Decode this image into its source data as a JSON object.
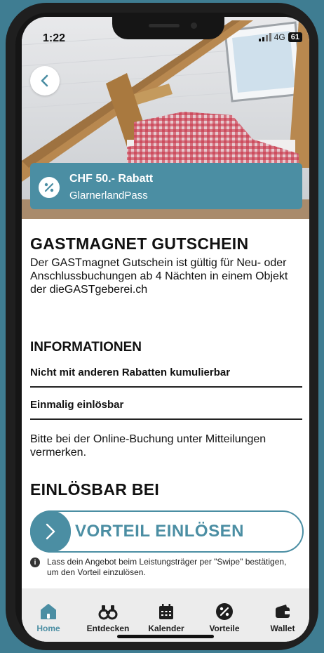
{
  "status_bar": {
    "time": "1:22",
    "network": "4G",
    "battery": "61"
  },
  "hero": {
    "back_button": "chevron-left-icon"
  },
  "discount": {
    "title": "CHF 50.- Rabatt",
    "partner": "GlarnerlandPass",
    "icon": "percent-icon"
  },
  "offer": {
    "title": "GASTMAGNET GUTSCHEIN",
    "description": "Der GASTmagnet Gutschein ist gültig für Neu- oder Anschlussbuchungen ab 4 Nächten in einem Objekt der dieGASTgeberei.ch"
  },
  "information": {
    "heading": "INFORMATIONEN",
    "items": [
      "Nicht mit anderen Rabatten kumulierbar",
      "Einmalig einlösbar"
    ],
    "note": "Bitte bei der Online-Buchung unter Mitteilun­gen vermerken."
  },
  "redeem": {
    "heading": "EINLÖSBAR BEI",
    "button_label": "VORTEIL EINLÖSEN",
    "hint": "Lass dein Angebot beim Leistungsträger per \"Swipe\" bestätigen, um den Vorteil einzulösen."
  },
  "tabbar": {
    "active": "Home",
    "items": [
      {
        "label": "Home",
        "icon": "home-icon"
      },
      {
        "label": "Entdecken",
        "icon": "binoculars-icon"
      },
      {
        "label": "Kalender",
        "icon": "calendar-icon"
      },
      {
        "label": "Vorteile",
        "icon": "percent-icon"
      },
      {
        "label": "Wallet",
        "icon": "wallet-icon"
      }
    ]
  },
  "colors": {
    "accent": "#4b8ea3",
    "background": "#3f7d92",
    "tabbar": "#ececec"
  }
}
